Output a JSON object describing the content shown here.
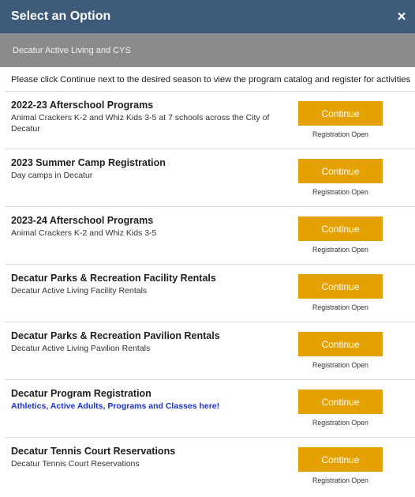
{
  "header": {
    "title": "Select an Option",
    "close_glyph": "×"
  },
  "subheader": {
    "text": "Decatur Active Living and CYS"
  },
  "instructions": "Please click Continue next to the desired season to view the program catalog and register for activities",
  "options": [
    {
      "name": "2022-23 Afterschool Programs",
      "description": "Animal Crackers K-2 and Whiz Kids 3-5 at 7 schools across the City of Decatur",
      "button": "Continue",
      "status": "Registration Open"
    },
    {
      "name": "2023 Summer Camp Registration",
      "description": "Day camps in Decatur",
      "button": "Continue",
      "status": "Registration Open"
    },
    {
      "name": "2023-24 Afterschool Programs",
      "description": "Animal Crackers K-2 and Whiz Kids 3-5",
      "button": "Continue",
      "status": "Registration Open"
    },
    {
      "name": "Decatur Parks & Recreation Facility Rentals",
      "description": "Decatur Active Living Facility Rentals",
      "button": "Continue",
      "status": "Registration Open"
    },
    {
      "name": "Decatur Parks & Recreation Pavilion Rentals",
      "description": "Decatur Active Living Pavilion Rentals",
      "button": "Continue",
      "status": "Registration Open"
    },
    {
      "name": "Decatur Program Registration",
      "description": "Athletics, Active Adults, Programs and Classes here!",
      "button": "Continue",
      "status": "Registration Open"
    },
    {
      "name": "Decatur Tennis Court Reservations",
      "description": "Decatur Tennis Court Reservations",
      "button": "Continue",
      "status": "Registration Open"
    }
  ],
  "colors": {
    "header_bg": "#3d5a78",
    "subheader_bg": "#8a8b8c",
    "button_bg": "#e5a100",
    "link_text": "#1b33c9"
  }
}
